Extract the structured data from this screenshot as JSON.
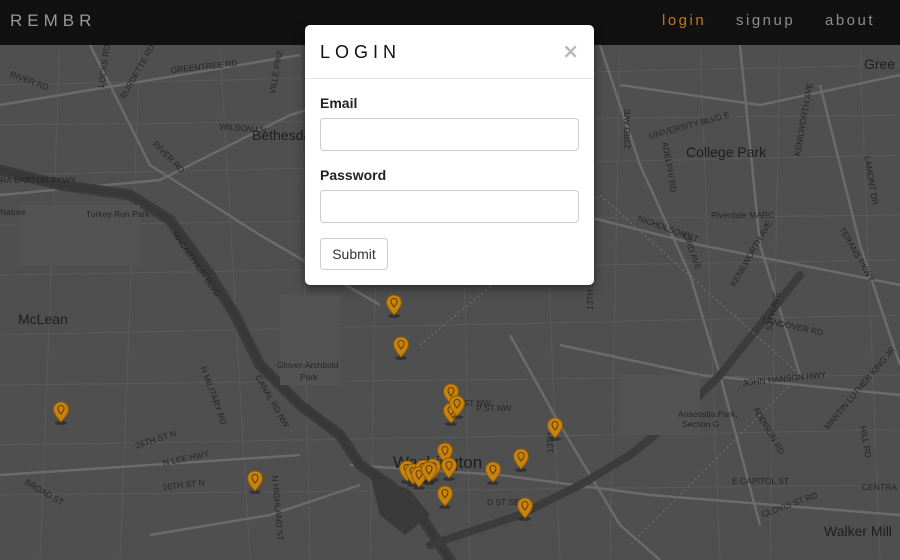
{
  "navbar": {
    "brand": "REMBR",
    "links": [
      {
        "label": "login",
        "active": true
      },
      {
        "label": "signup",
        "active": false
      },
      {
        "label": "about",
        "active": false
      }
    ],
    "active_color": "#c8770f"
  },
  "modal": {
    "title": "LOGIN",
    "close_glyph": "×",
    "email_label": "Email",
    "email_value": "",
    "password_label": "Password",
    "password_value": "",
    "submit_label": "Submit"
  },
  "map": {
    "labels": {
      "river_rd": "RIVER RD",
      "burdette_rd": "BURDETTE RD",
      "greentree_rd": "GREENTREE RD",
      "ville_pike": "VILLE PIKE",
      "locks_rd": "LOCKS RD",
      "wilson_ln": "WILSON LN",
      "bethesda": "Bethesda",
      "river_rd_2": "RIVER RD",
      "clara_barton_pkwy": "RA BARTON PKWY",
      "nature": "Nature",
      "turkey_run_park": "Turkey Run Park",
      "mcarthur_blvd": "MACARTHUR BLVD",
      "mclean": "McLean",
      "glover_archbold": "Glover-Archbold",
      "park": "Park",
      "n_military_rd": "N MILITARY RD",
      "canal_rd_nw": "CANAL RD NW",
      "st_26th_n": "26TH ST N",
      "n_lee_hwy": "N LEE HWY",
      "st_16th_n": "16TH ST N",
      "broad_st": "BROAD ST",
      "highland_st": "N HIGHLAND ST",
      "washington": "Washington",
      "college_park": "College Park",
      "riverdale_marc": "Riverdale MARC",
      "university_blvd_e": "UNIVERSITY BLVD E",
      "adelphi_rd": "ADELPHI RD",
      "nicholson_st": "NICHOLSON ST",
      "ave_23rd": "23RD AVE",
      "kenilworth_ave": "KENILWORTH AVE",
      "landover_rd": "LANDOVER RD",
      "john_hanson_hwy": "JOHN HANSON HWY",
      "anacostia_park": "Anacostia Park,",
      "section_g": "Section G",
      "addison_rd": "ADDISON RD",
      "e_capitol_st": "E CAPITOL ST",
      "d_st_se": "D ST SE",
      "p_st_nw": "P ST NW",
      "t_st_nw": "T ST NW",
      "st_13th_ne": "13TH ST NE",
      "st_16th_nw": "16TH ST NW",
      "walker_mill": "Walker Mill",
      "greenbelt": "Gree",
      "lamont_dr": "LAMONT DR",
      "terans_pkwy": "TERANS PKWY",
      "mlk_ave": "MARTIN LUTHER KING JR",
      "hill_rd": "HILL RD",
      "centra": "CENTRA",
      "clovis_rd": "CLOVIS ST RD",
      "ave_57th": "57TH AVE",
      "kenilworth_ave_2": "KENILWORTH AVE",
      "sth_13": "13TH",
      "ave_33rd": "33RD AVE",
      "kenilworth_ave_3": "KENILWORTH AVE"
    },
    "marker_color": "#c8820e",
    "marker_count": 20
  }
}
